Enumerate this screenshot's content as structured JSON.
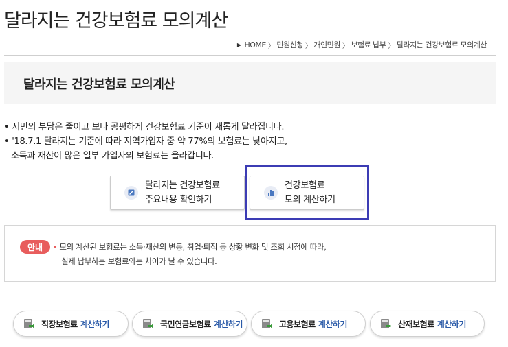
{
  "page": {
    "title": "달라지는 건강보험료 모의계산"
  },
  "breadcrumb": {
    "items": [
      "HOME",
      "민원신청",
      "개인민원",
      "보험료 납부",
      "달라지는 건강보험료 모의계산"
    ],
    "separator": "〉"
  },
  "section": {
    "title": "달라지는 건강보험료 모의계산"
  },
  "intro": {
    "line1": "• 서민의 부담은 줄이고 보다 공평하게 건강보험료 기준이 새롭게 달라집니다.",
    "line2": "• '18.7.1 달라지는 기준에 따라 지역가입자 중 약 77%의 보험료는 낮아지고,",
    "line3": "소득과 재산이 많은 일부 가입자의 보험료는 올라갑니다."
  },
  "buttons": {
    "summary_line1": "달라지는 건강보험료",
    "summary_line2": "주요내용 확인하기",
    "calc_line1": "건강보험료",
    "calc_line2": "모의 계산하기"
  },
  "notice": {
    "badge": "안내",
    "line1": "모의 계산된 보험료는 소득·재산의 변동, 취업·퇴직 등 상황 변화 및 조회 시점에 따라,",
    "line2": "실제 납부하는 보험료와는 차이가 날 수 있습니다."
  },
  "calculators": [
    {
      "name": "직장보험료",
      "action": "계산하기"
    },
    {
      "name": "국민연금보험료",
      "action": "계산하기"
    },
    {
      "name": "고용보험료",
      "action": "계산하기"
    },
    {
      "name": "산재보험료",
      "action": "계산하기"
    }
  ],
  "colors": {
    "highlight": "#3c3cb4",
    "notice_badge": "#e85d5d",
    "action_text": "#2a5aa8",
    "icon_green": "#3a9a3a"
  },
  "icons": {
    "summary": "document-icon",
    "calc": "bar-chart-icon",
    "calculator": "calculator-arrow-icon"
  }
}
